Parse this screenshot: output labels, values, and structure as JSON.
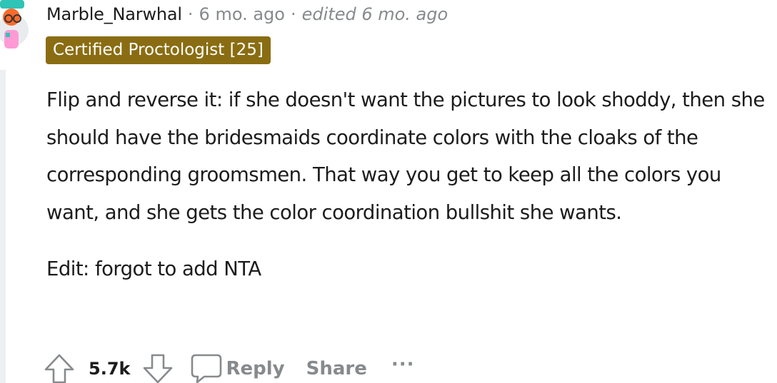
{
  "comment": {
    "username": "Marble_Narwhal",
    "separator": "·",
    "time": "6 mo. ago",
    "edited": "edited 6 mo. ago",
    "flair": "Certified Proctologist [25]",
    "flair_color": "#8a6d12",
    "body_paragraphs": [
      "Flip and reverse it: if she doesn't want the pictures to look shoddy, then she should have the bridesmaids coordinate colors with the cloaks of the corresponding groomsmen. That way you get to keep all the colors you want, and she gets the color coordination bullshit she wants.",
      "Edit: forgot to add NTA"
    ]
  },
  "actions": {
    "upvote_icon": "upvote-arrow-icon",
    "score": "5.7k",
    "downvote_icon": "downvote-arrow-icon",
    "reply_icon": "speech-bubble-icon",
    "reply_label": "Reply",
    "share_label": "Share",
    "more_label": "···"
  },
  "colors": {
    "text": "#1c1c1c",
    "muted": "#878a8c",
    "thread_line": "#edeff1"
  }
}
